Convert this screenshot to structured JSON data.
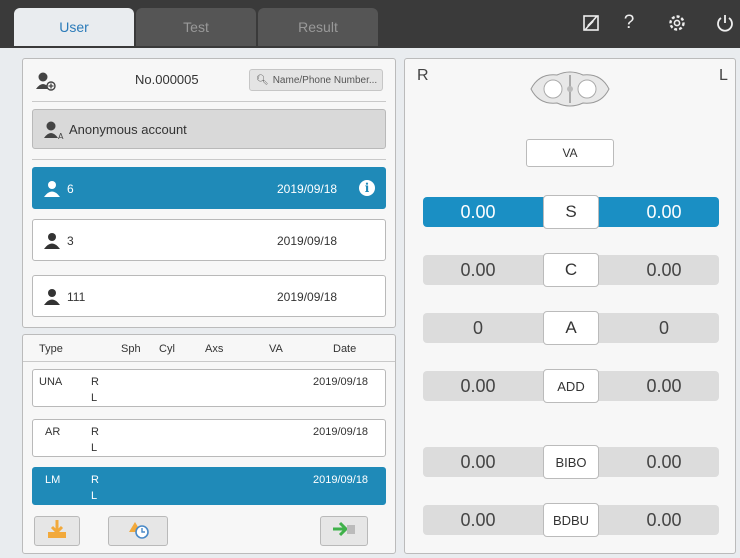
{
  "tabs": [
    {
      "label": "User",
      "active": true
    },
    {
      "label": "Test",
      "active": false
    },
    {
      "label": "Result",
      "active": false
    }
  ],
  "top_icons": [
    "eyedropper-off-icon",
    "help-icon",
    "settings-icon",
    "power-icon"
  ],
  "user_panel": {
    "number": "No.000005",
    "search_placeholder": "Name/Phone Number...",
    "anonymous_label": "Anonymous account",
    "users": [
      {
        "name": "6",
        "date": "2019/09/18",
        "selected": true
      },
      {
        "name": "3",
        "date": "2019/09/18",
        "selected": false
      },
      {
        "name": "111",
        "date": "2019/09/18",
        "selected": false
      }
    ]
  },
  "records": {
    "headers": [
      "Type",
      "Sph",
      "Cyl",
      "Axs",
      "VA",
      "Date"
    ],
    "rows": [
      {
        "type": "UNA",
        "eye_r": "R",
        "eye_l": "L",
        "date": "2019/09/18",
        "selected": false
      },
      {
        "type": "AR",
        "eye_r": "R",
        "eye_l": "L",
        "date": "2019/09/18",
        "selected": false
      },
      {
        "type": "LM",
        "eye_r": "R",
        "eye_l": "L",
        "date": "2019/09/18",
        "selected": true
      }
    ]
  },
  "right_panel": {
    "right_label": "R",
    "left_label": "L",
    "va_button": "VA",
    "measurements": [
      {
        "key": "S",
        "right": "0.00",
        "left": "0.00",
        "selected": true
      },
      {
        "key": "C",
        "right": "0.00",
        "left": "0.00",
        "selected": false
      },
      {
        "key": "A",
        "right": "0",
        "left": "0",
        "selected": false
      },
      {
        "key": "ADD",
        "right": "0.00",
        "left": "0.00",
        "selected": false
      },
      {
        "key": "BIBO",
        "right": "0.00",
        "left": "0.00",
        "selected": false
      },
      {
        "key": "BDBU",
        "right": "0.00",
        "left": "0.00",
        "selected": false
      }
    ]
  },
  "colors": {
    "accent": "#1f8ab8",
    "topbar": "#3a3a3a"
  }
}
